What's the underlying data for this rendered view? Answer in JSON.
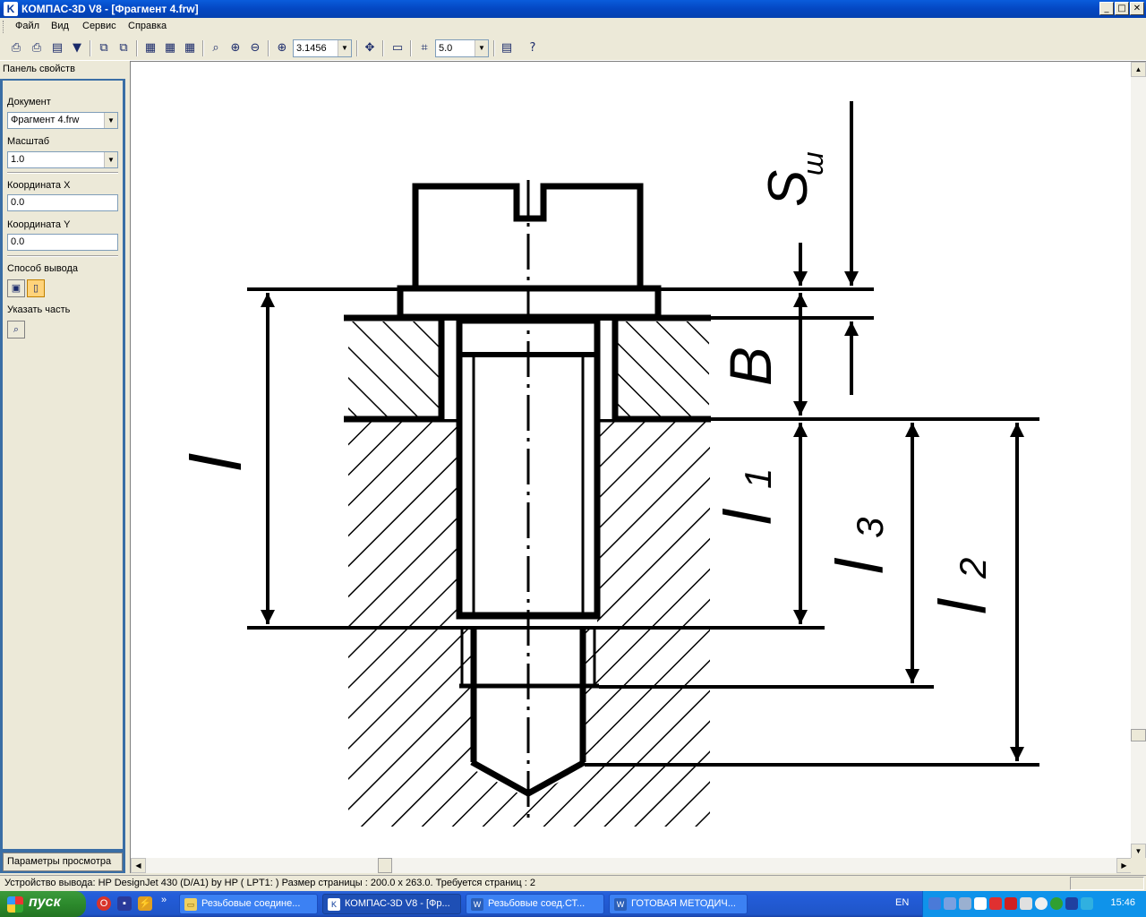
{
  "window": {
    "title": "КОМПАС-3D V8 - [Фрагмент 4.frw]",
    "app_icon": "K"
  },
  "menu": [
    "Файл",
    "Вид",
    "Сервис",
    "Справка"
  ],
  "toolbar": {
    "zoom_value": "3.1456",
    "step_value": "5.0"
  },
  "panel": {
    "header": "Панель свойств",
    "document_label": "Документ",
    "document_value": "Фрагмент 4.frw",
    "scale_label": "Масштаб",
    "scale_value": "1.0",
    "coord_x_label": "Координата X",
    "coord_x_value": "0.0",
    "coord_y_label": "Координата Y",
    "coord_y_value": "0.0",
    "output_mode_label": "Способ вывода",
    "select_part_label": "Указать часть",
    "footer_tab": "Параметры просмотра"
  },
  "drawing": {
    "labels": {
      "s_w": "S",
      "s_w_sub": "ш",
      "b": "B",
      "l": "l",
      "l1": "l",
      "l1_sub": "1",
      "l3": "l",
      "l3_sub": "3",
      "l2": "l",
      "l2_sub": "2"
    }
  },
  "status": {
    "text": "Устройство вывода: HP DesignJet 430 (D/A1) by HP ( LPT1: )  Размер страницы : 200.0 x 263.0.  Требуется страниц : 2"
  },
  "taskbar": {
    "start_label": "пуск",
    "tasks": [
      {
        "label": "Резьбовые соедине...",
        "icon": "folder-icon"
      },
      {
        "label": "КОМПАС-3D V8 - [Фр...",
        "icon": "kompas-icon"
      },
      {
        "label": "Резьбовые соед.СТ...",
        "icon": "word-icon"
      },
      {
        "label": "ГОТОВАЯ МЕТОДИЧ...",
        "icon": "word-icon"
      }
    ],
    "language": "EN",
    "clock": "15:46"
  }
}
